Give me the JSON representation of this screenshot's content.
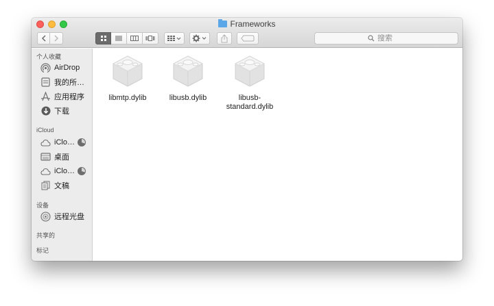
{
  "window": {
    "title": "Frameworks"
  },
  "toolbar": {
    "back_icon": "chevron-left-icon",
    "forward_icon": "chevron-right-icon",
    "view_modes": [
      "icon-view",
      "list-view",
      "column-view",
      "coverflow-view"
    ],
    "active_view": "icon-view",
    "arrange_icon": "arrange-grid-icon",
    "action_icon": "gear-icon",
    "share_icon": "share-icon",
    "tags_icon": "tag-icon",
    "search_placeholder": "搜索"
  },
  "sidebar": {
    "favorites_heading": "个人收藏",
    "favorites": [
      {
        "label": "AirDrop",
        "icon": "airdrop-icon"
      },
      {
        "label": "我的所…",
        "icon": "all-files-icon"
      },
      {
        "label": "应用程序",
        "icon": "applications-icon"
      },
      {
        "label": "下载",
        "icon": "downloads-icon"
      }
    ],
    "icloud_heading": "iCloud",
    "icloud": [
      {
        "label": "iClo…",
        "icon": "cloud-icon"
      },
      {
        "label": "桌面",
        "icon": "desktop-icon"
      },
      {
        "label": "iClo…",
        "icon": "cloud-icon"
      },
      {
        "label": "文稿",
        "icon": "documents-icon"
      }
    ],
    "devices_heading": "设备",
    "devices": [
      {
        "label": "远程光盘",
        "icon": "optical-disc-icon"
      }
    ],
    "shared_heading": "共享的",
    "tags_heading": "标记"
  },
  "files": [
    {
      "name": "libmtp.dylib",
      "icon": "dylib-icon"
    },
    {
      "name": "libusb.dylib",
      "icon": "dylib-icon"
    },
    {
      "name": "libusb-standard.dylib",
      "line1": "libusb-",
      "line2": "standard.dylib",
      "icon": "dylib-icon"
    }
  ]
}
